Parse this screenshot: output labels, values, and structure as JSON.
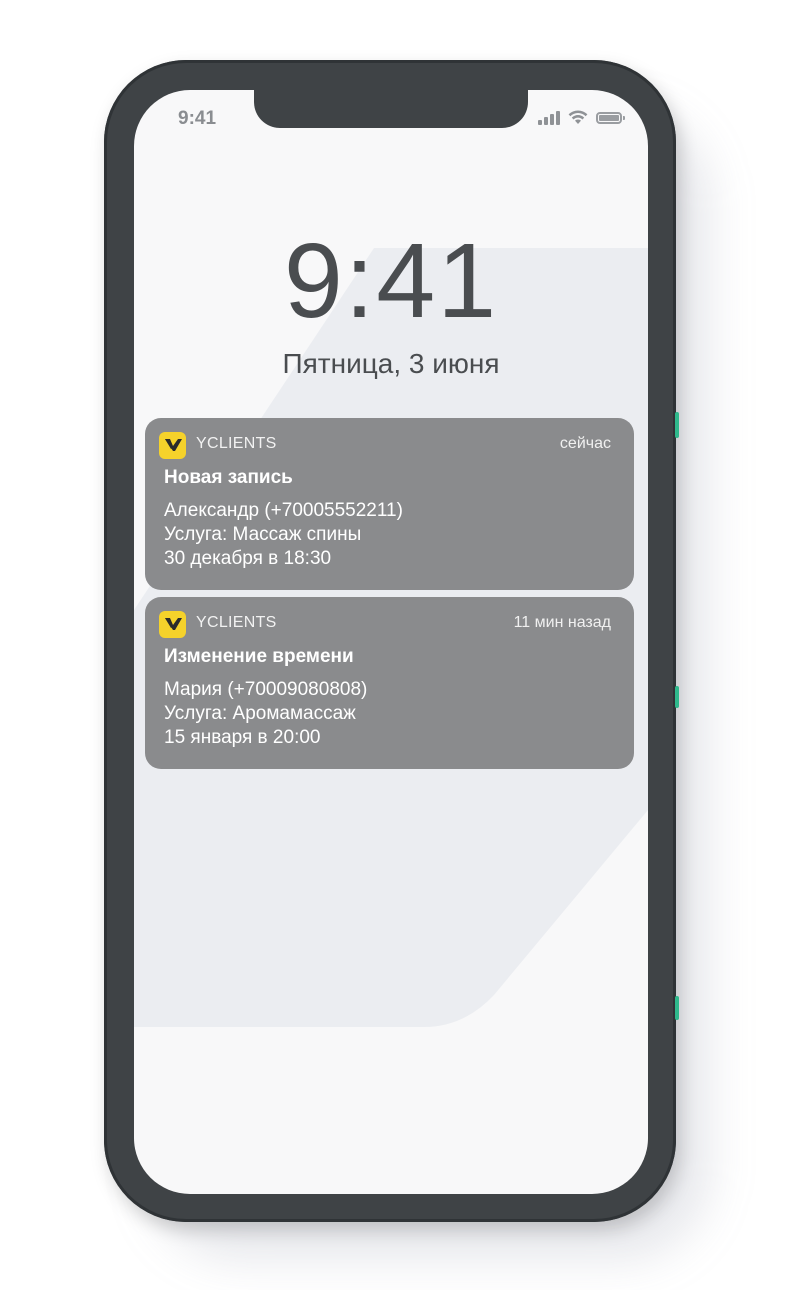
{
  "status_bar": {
    "time": "9:41"
  },
  "lock_screen": {
    "time": "9:41",
    "date": "Пятница, 3 июня"
  },
  "notifications": [
    {
      "app_name": "YCLIENTS",
      "time": "сейчас",
      "title": "Новая запись",
      "lines": [
        "Александр (+70005552211)",
        "Услуга: Массаж спины",
        "30 декабря в 18:30"
      ]
    },
    {
      "app_name": "YCLIENTS",
      "time": "11 мин назад",
      "title": "Изменение времени",
      "lines": [
        "Мария (+70009080808)",
        "Услуга: Аромамассаж",
        "15 января в 20:00"
      ]
    }
  ],
  "colors": {
    "app_icon": "#f5d22b",
    "notification_bg": "#8a8b8d",
    "phone_frame": "#3f4346",
    "side_button": "#2fb98c"
  }
}
